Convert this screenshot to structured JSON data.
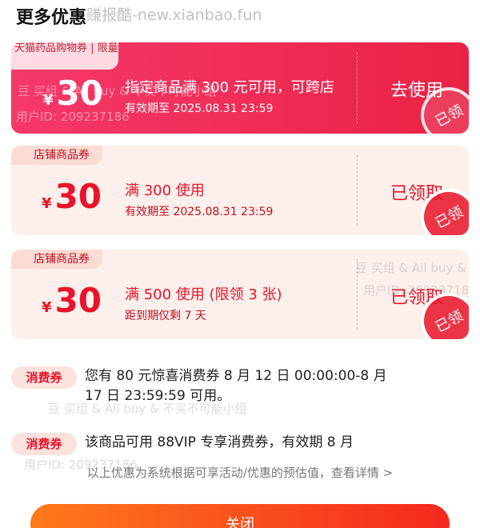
{
  "header": {
    "title": "更多优惠",
    "watermark": "赚报酷-new.xianbao.fun"
  },
  "coupons": [
    {
      "tag": "天猫药品购物券 | 限量",
      "currency": "¥",
      "amount": "30",
      "condition": "指定商品满 300 元可用，可跨店",
      "validity": "有效期至 2025.08.31 23:59",
      "action": "去使用",
      "stamp": "已领",
      "style": "primary"
    },
    {
      "tag": "店铺商品券",
      "currency": "¥",
      "amount": "30",
      "condition": "满 300 使用",
      "validity": "有效期至 2025.08.31 23:59",
      "action": "已领取",
      "stamp": "已领",
      "style": "store"
    },
    {
      "tag": "店铺商品券",
      "currency": "¥",
      "amount": "30",
      "condition": "满 500 使用 (限领 3 张)",
      "validity": "距到期仅剩 7 天",
      "action": "已领取",
      "stamp": "已领",
      "style": "store"
    }
  ],
  "vouchers": [
    {
      "badge": "消费券",
      "text": "您有 80 元惊喜消费券 8 月 12 日 00:00:00-8 月 17 日 23:59:59 可用。"
    },
    {
      "badge": "消费券",
      "text": "该商品可用 88VIP 专享消费券，有效期 8 月"
    }
  ],
  "footnote": "以上优惠为系统根据可享活动/优惠的预估值，查看详情 >",
  "close_button": "关闭",
  "watermarks": {
    "brand": "豆 买组 & All buy & 不买不可能小组",
    "user": "用户ID: 209237186"
  },
  "colors": {
    "primary_coupon": "#ea2344",
    "accent_red": "#e8142a",
    "store_coupon_bg": "#fdf0ec",
    "close_button": "#f5281f"
  }
}
